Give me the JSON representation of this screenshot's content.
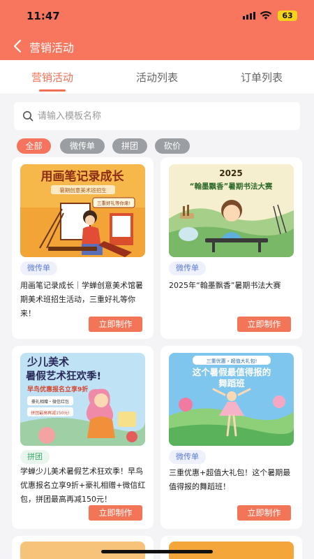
{
  "status": {
    "time": "11:47",
    "battery": "63"
  },
  "nav": {
    "title": "营销活动"
  },
  "tabs": [
    {
      "label": "营销活动"
    },
    {
      "label": "活动列表"
    },
    {
      "label": "订单列表"
    }
  ],
  "search": {
    "placeholder": "请输入模板名称",
    "value": ""
  },
  "filters": [
    "全部",
    "微传单",
    "拼团",
    "砍价"
  ],
  "cards": [
    {
      "image_title": "用画笔记录成长",
      "image_subtitle": "暑期创意美术班招生",
      "image_badge": "三重好礼等你来!",
      "tag": "微传单",
      "desc": "用画笔记录成长｜学蝉创意美术馆暑期美术班招生活动，三重好礼等你来！",
      "button": "立即制作"
    },
    {
      "image_year": "2025",
      "image_title": "“翰墨飘香”暑期书法大赛",
      "tag": "微传单",
      "desc": "2025年“翰墨飘香”暑期书法大赛",
      "button": "立即制作"
    },
    {
      "image_title_1": "少儿美术",
      "image_title_2": "暑假艺术狂欢季!",
      "image_sub": "早鸟优惠报名立享9折",
      "image_gift": "豪礼相赠・微信红包",
      "image_group": "拼团最高再减150元!",
      "tag": "拼团",
      "desc": "学蝉少儿美术暑假艺术狂欢季！早鸟优惠报名立享9折+豪礼相赠+微信红包，拼团最高再减150元！",
      "button": "立即制作"
    },
    {
      "image_top": "三重优惠・超值大礼包!",
      "image_title_1": "这个暑假最值得报的",
      "image_title_2": "舞蹈班",
      "tag": "微传单",
      "desc": "三重优惠+超值大礼包！这个暑期最值得报的舞蹈班！",
      "button": "立即制作"
    }
  ],
  "colors": {
    "accent": "#f8765e",
    "chip_active": "#f6735d",
    "chip": "#9b9ea3",
    "tag_blue": "#5b7bd5",
    "tag_green": "#3aa86a"
  }
}
